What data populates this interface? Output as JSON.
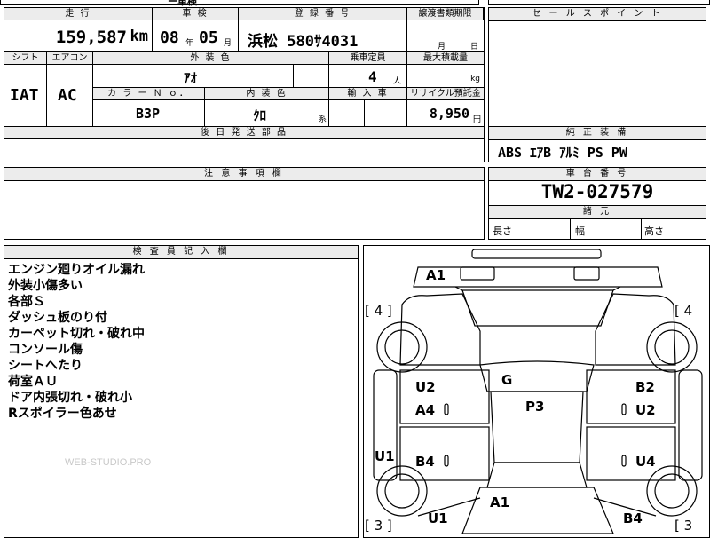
{
  "top_strip": {
    "fragment": "ー車検"
  },
  "vehicle": {
    "mileage_label": "走 行",
    "mileage_value": "159,587",
    "mileage_unit": "km",
    "inspection_label": "車 検",
    "inspection_year": "08",
    "year_unit": "年",
    "inspection_month": "05",
    "month_unit": "月",
    "plate_label": "登 録 番 号",
    "plate_value": "浜松 580ｻ4031",
    "transfer_label": "譲渡書類期限",
    "transfer_month_unit": "月",
    "transfer_day_unit": "日",
    "shift_label": "シフト",
    "shift_value": "IAT",
    "ac_label": "エアコン",
    "ac_value": "AC",
    "exterior_label": "外 装 色",
    "exterior_value": "ｱｵ",
    "capacity_label": "乗車定員",
    "capacity_value": "4",
    "capacity_unit": "人",
    "load_label": "最大積載量",
    "load_unit": "kg",
    "color_no_label": "カ ラ ー Ｎ ｏ．",
    "color_no_value": "B3P",
    "interior_label": "内 装 色",
    "interior_value": "ｸﾛ",
    "interior_suffix": "系",
    "import_label": "輸 入 車",
    "recycle_label": "リサイクル預託金",
    "recycle_value": "8,950",
    "recycle_unit": "円",
    "parts_label": "後 日 発 送 部 品"
  },
  "sales_point": {
    "label": "セ ー ル ス ポ イ ン ト"
  },
  "equipment": {
    "label": "純 正 装 備",
    "value": "ABS ｴｱB ｱﾙﾐ PS PW"
  },
  "caution": {
    "label": "注 意 事 項 欄"
  },
  "chassis": {
    "label": "車 台 番 号",
    "value": "TW2-027579",
    "dims_label": "諸 元",
    "length_label": "長さ",
    "width_label": "幅",
    "height_label": "高さ"
  },
  "inspector": {
    "label": "検 査 員 記 入 欄",
    "notes": [
      "エンジン廻りオイル漏れ",
      "外装小傷多い",
      "各部Ｓ",
      "ダッシュ板のり付",
      "カーペット切れ・破れ中",
      "コンソール傷",
      "シートへたり",
      "荷室ＡＵ",
      "ドア内張切れ・破れ小",
      "Rスポイラー色あせ"
    ],
    "watermark": "WEB-STUDIO.PRO"
  },
  "diagram": {
    "marks": {
      "a1_front": "A1",
      "tire_fl": "[ 4 ]",
      "tire_fr": "[ 4",
      "tire_rl": "[ 3 ]",
      "tire_rr": "[ 3",
      "u2_left": "U2",
      "g_roof": "G",
      "b2_right": "B2",
      "a4_left": "A4",
      "p3_center": "P3",
      "u2_right": "U2",
      "u1_side": "U1",
      "b4_left": "B4",
      "u4_right": "U4",
      "a1_rear": "A1",
      "u1_rear": "U1",
      "b4_rear": "B4"
    }
  }
}
